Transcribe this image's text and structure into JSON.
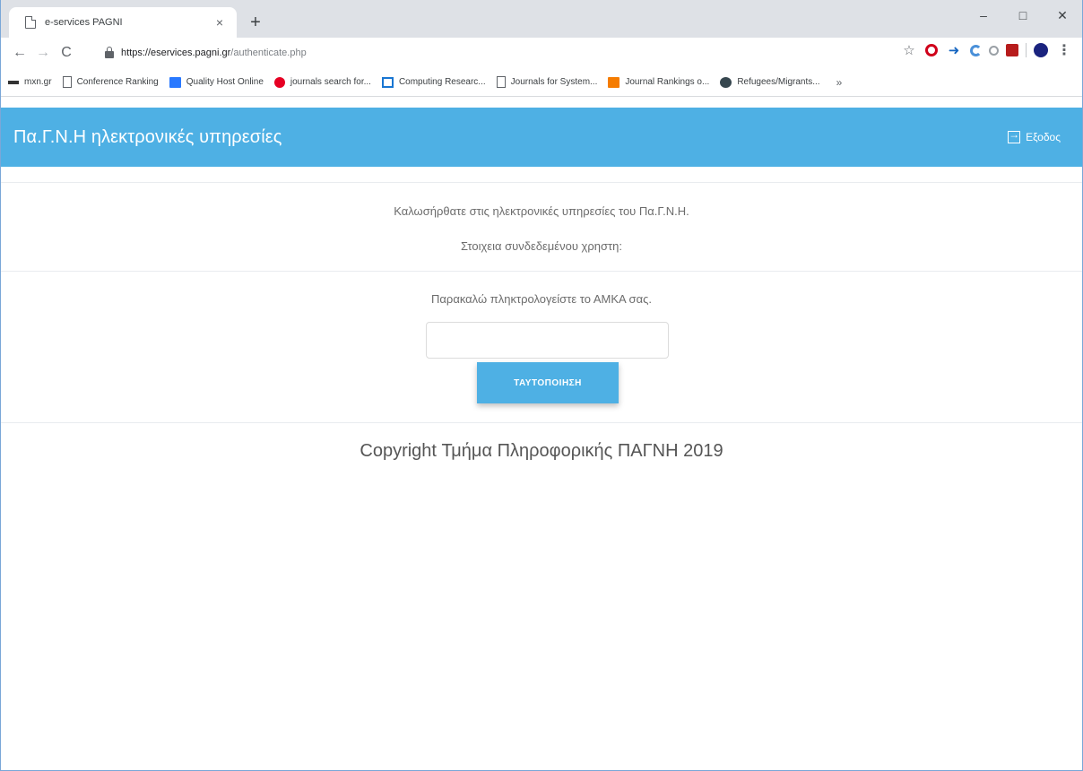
{
  "browser": {
    "tab_title": "e-services PAGNI",
    "tab_close": "×",
    "new_tab": "+",
    "window_controls": {
      "minimize": "–",
      "maximize": "□",
      "close": "✕"
    },
    "nav": {
      "back": "←",
      "forward": "→",
      "reload": "C"
    },
    "url_host": "https://eservices.pagni.gr",
    "url_path": "/authenticate.php",
    "extensions": [
      "star-icon",
      "opera-icon",
      "arrow-icon",
      "g-icon",
      "circle-icon",
      "red-box-icon",
      "globe-icon",
      "menu-dots-icon"
    ],
    "menu_glyph": "⋮",
    "star_glyph": "☆",
    "arrow_glyph": "➜",
    "bookmarks": [
      {
        "label": "mxn.gr",
        "icon": "mxn"
      },
      {
        "label": "Conference Ranking",
        "icon": "page"
      },
      {
        "label": "Quality Host Online",
        "icon": "qho"
      },
      {
        "label": "journals search for...",
        "icon": "pin"
      },
      {
        "label": "Computing Researc...",
        "icon": "cr"
      },
      {
        "label": "Journals for System...",
        "icon": "page"
      },
      {
        "label": "Journal Rankings o...",
        "icon": "jr"
      },
      {
        "label": "Refugees/Migrants...",
        "icon": "un"
      }
    ],
    "bookmarks_more": "»"
  },
  "page": {
    "app_title": "Πα.Γ.Ν.Η ηλεκτρονικές υπηρεσίες",
    "exit_label": "Εξοδος",
    "welcome_text": "Καλωσήρθατε στις ηλεκτρονικές υπηρεσίες του Πα.Γ.Ν.Η.",
    "user_info_text": "Στοιχεια συνδεδεμένου χρηστη:",
    "prompt_text": "Παρακαλώ πληκτρολογείστε το ΑΜΚΑ σας.",
    "amka_value": "",
    "amka_placeholder": "",
    "submit_label": "ΤΑΥΤΟΠΟΙΗΣΗ",
    "copyright": "Copyright Τμήμα Πληροφορικής ΠΑΓΝΗ 2019"
  },
  "colors": {
    "accent": "#4eb0e4",
    "tabstrip": "#dee1e6"
  }
}
